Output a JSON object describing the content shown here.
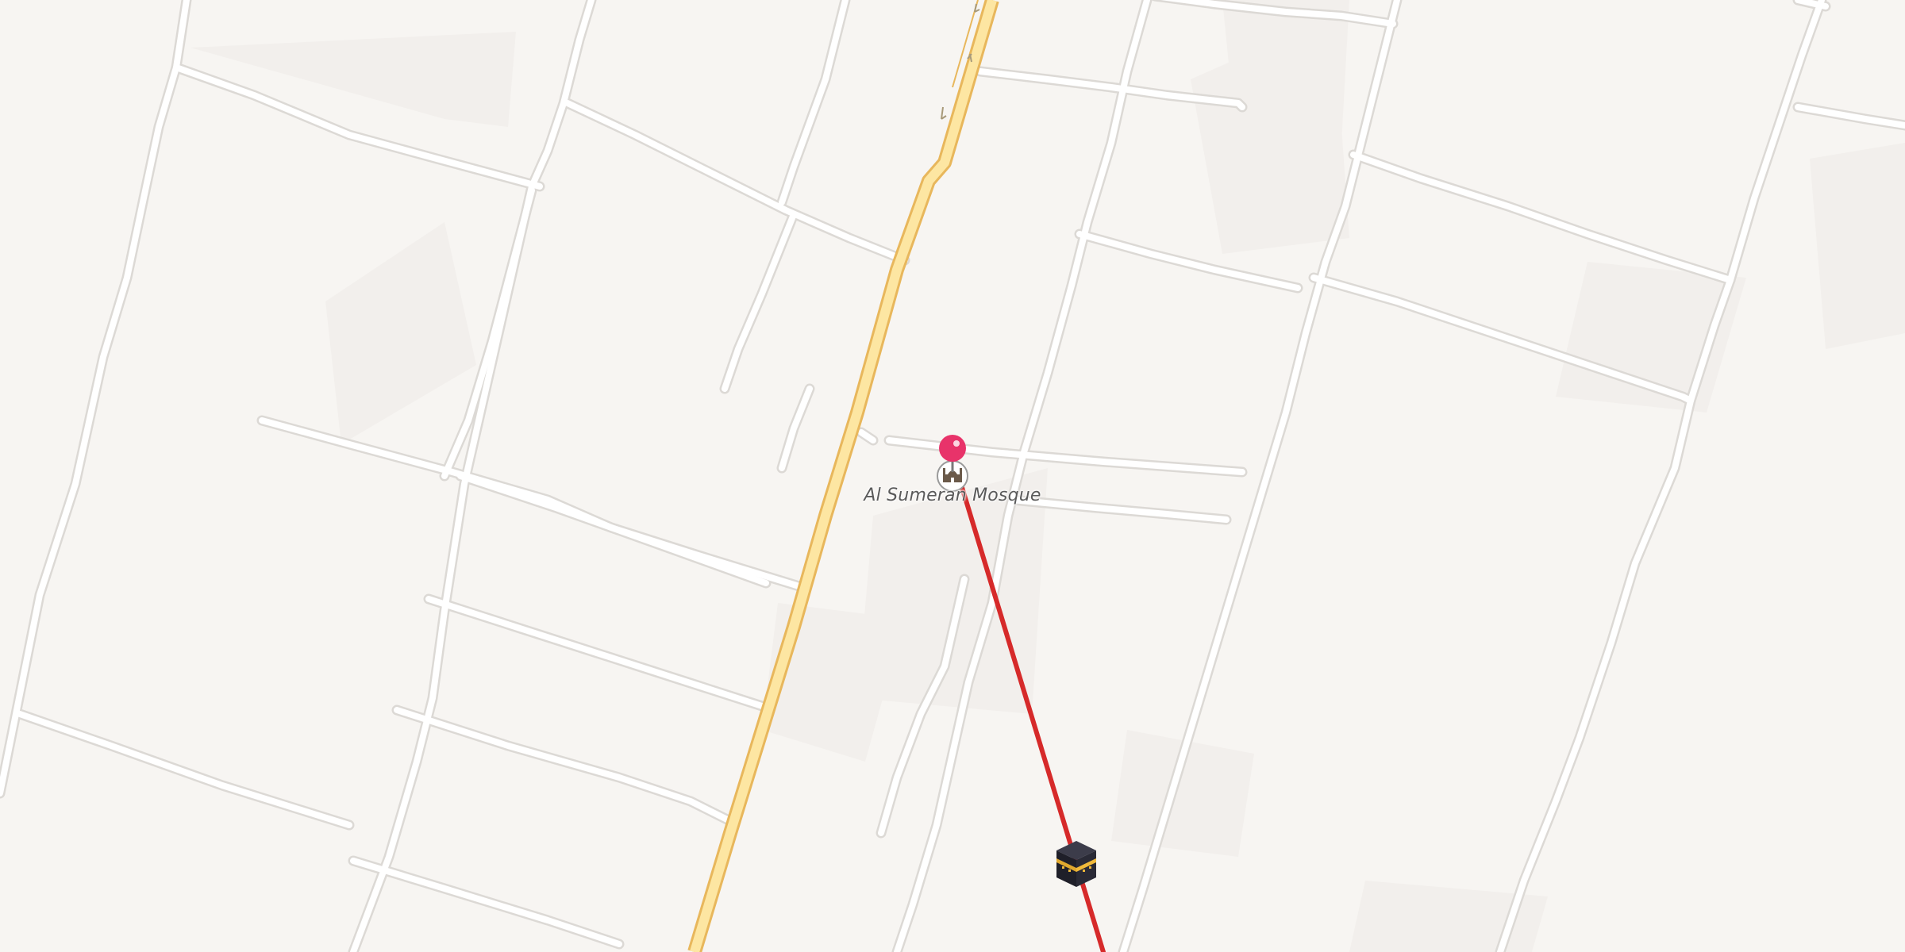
{
  "map": {
    "poi": {
      "name": "Al Sumeran Mosque",
      "icon": "mosque-icon"
    },
    "destination_marker": {
      "icon": "kaaba-icon",
      "meaning": "qibla direction"
    },
    "location_pin": {
      "icon": "red-pin-icon",
      "color": "#e8336a"
    },
    "colors": {
      "background": "#f7f5f2",
      "road": "#ffffff",
      "road_casing": "#dcd9d5",
      "main_road": "#fde6a2",
      "main_road_casing": "#e8b75c",
      "qibla_line": "#d62a2a"
    }
  }
}
